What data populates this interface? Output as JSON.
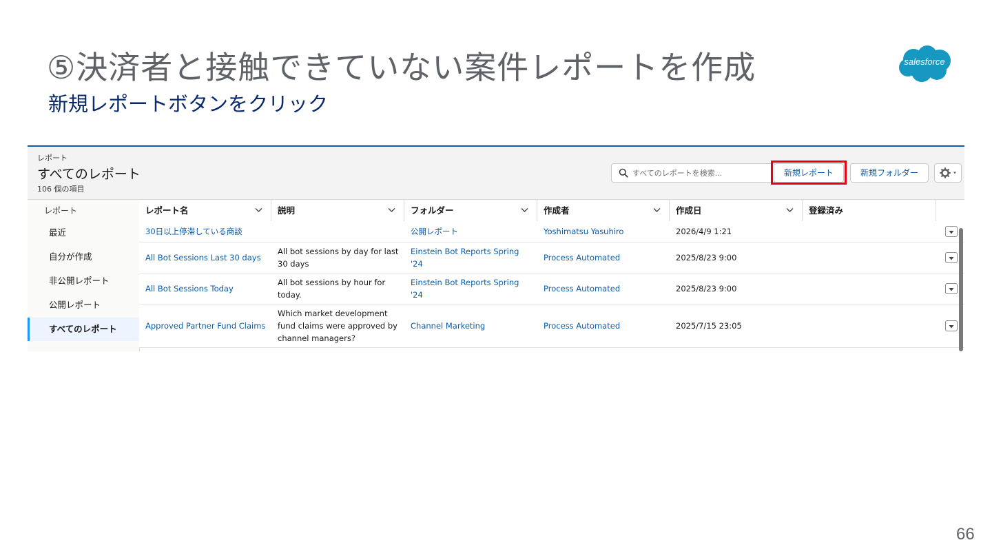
{
  "slide": {
    "title": "⑤決済者と接触できていない案件レポートを作成",
    "subtitle": "新規レポートボタンをクリック",
    "logo_text": "salesforce",
    "page_number": "66",
    "logo_color": "#1798c1"
  },
  "header": {
    "kicker": "レポート",
    "title": "すべてのレポート",
    "item_count": "106 個の項目"
  },
  "search": {
    "placeholder": "すべてのレポートを検索..."
  },
  "actions": {
    "new_report": "新規レポート",
    "new_folder": "新規フォルダー",
    "settings_icon": "gear-icon"
  },
  "highlight_color": "#e60012",
  "sidebar": {
    "title": "レポート",
    "items": [
      {
        "label": "最近"
      },
      {
        "label": "自分が作成"
      },
      {
        "label": "非公開レポート"
      },
      {
        "label": "公開レポート"
      },
      {
        "label": "すべてのレポート"
      }
    ]
  },
  "table": {
    "columns": [
      "レポート名",
      "説明",
      "フォルダー",
      "作成者",
      "作成日",
      "登録済み"
    ],
    "rows": [
      {
        "name": "30日以上停滞している商談",
        "description": "",
        "folder": "公開レポート",
        "created_by": "Yoshimatsu Yasuhiro",
        "created_date": "2026/4/9 1:21"
      },
      {
        "name": "All Bot Sessions Last 30 days",
        "description": "All bot sessions by day for last 30 days",
        "folder": "Einstein Bot Reports Spring '24",
        "created_by": "Process Automated",
        "created_date": "2025/8/23 9:00"
      },
      {
        "name": "All Bot Sessions Today",
        "description": "All bot sessions by hour for today.",
        "folder": "Einstein Bot Reports Spring '24",
        "created_by": "Process Automated",
        "created_date": "2025/8/23 9:00"
      },
      {
        "name": "Approved Partner Fund Claims",
        "description": "Which market development fund claims were approved by channel managers?",
        "folder": "Channel Marketing",
        "created_by": "Process Automated",
        "created_date": "2025/7/15 23:05"
      }
    ]
  }
}
